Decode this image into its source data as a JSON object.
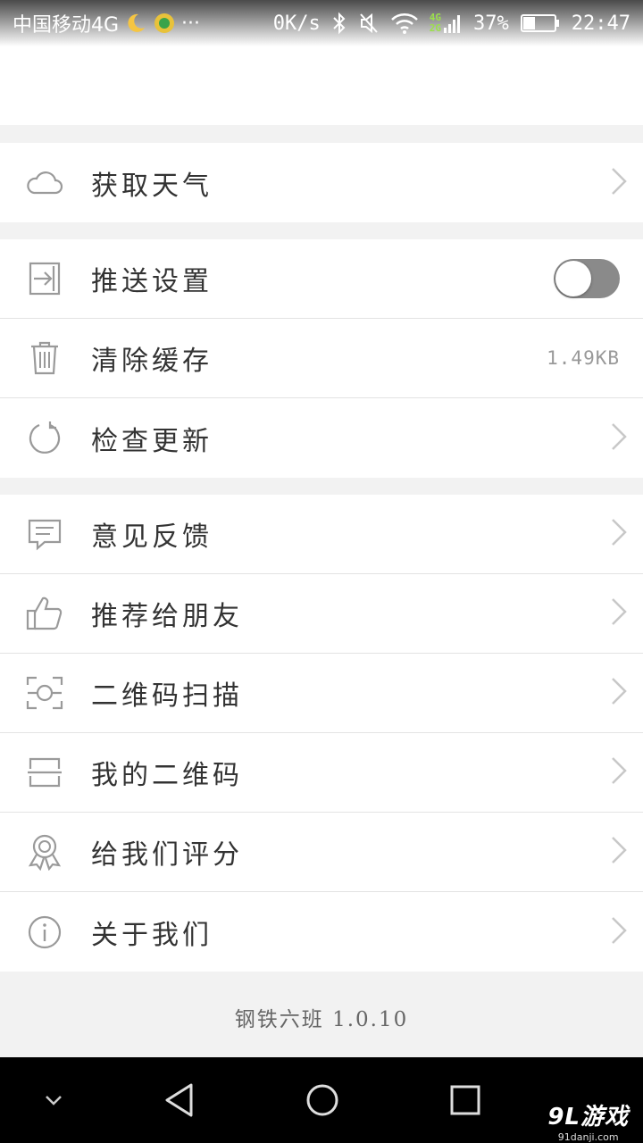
{
  "status_bar": {
    "carrier": "中国移动4G",
    "more": "···",
    "net_speed": "0K/s",
    "network_type_top": "4G",
    "network_type_bottom": "2G",
    "battery_percent": "37%",
    "battery_level": 0.37,
    "time": "22:47"
  },
  "groups": [
    {
      "items": [
        {
          "icon": "cloud-icon",
          "label": "获取天气",
          "accessory": "chevron"
        }
      ]
    },
    {
      "items": [
        {
          "icon": "push-icon",
          "label": "推送设置",
          "accessory": "toggle",
          "toggle_on": false
        },
        {
          "icon": "trash-icon",
          "label": "清除缓存",
          "accessory": "value",
          "value": "1.49KB"
        },
        {
          "icon": "refresh-icon",
          "label": "检查更新",
          "accessory": "chevron"
        }
      ]
    },
    {
      "items": [
        {
          "icon": "message-icon",
          "label": "意见反馈",
          "accessory": "chevron"
        },
        {
          "icon": "thumbs-up-icon",
          "label": "推荐给朋友",
          "accessory": "chevron"
        },
        {
          "icon": "scan-icon",
          "label": "二维码扫描",
          "accessory": "chevron"
        },
        {
          "icon": "qr-code-icon",
          "label": "我的二维码",
          "accessory": "chevron"
        },
        {
          "icon": "badge-icon",
          "label": "给我们评分",
          "accessory": "chevron"
        },
        {
          "icon": "info-icon",
          "label": "关于我们",
          "accessory": "chevron"
        }
      ]
    }
  ],
  "footer": {
    "version_text": "钢铁六班 1.0.10"
  },
  "watermark": {
    "main": "9L游戏",
    "sub": "91danji.com"
  },
  "colors": {
    "icon_gray": "#9a9a9a",
    "chevron_gray": "#c8c8c8",
    "text": "#333333",
    "separator": "#e3e3e3",
    "background": "#f2f2f2"
  }
}
